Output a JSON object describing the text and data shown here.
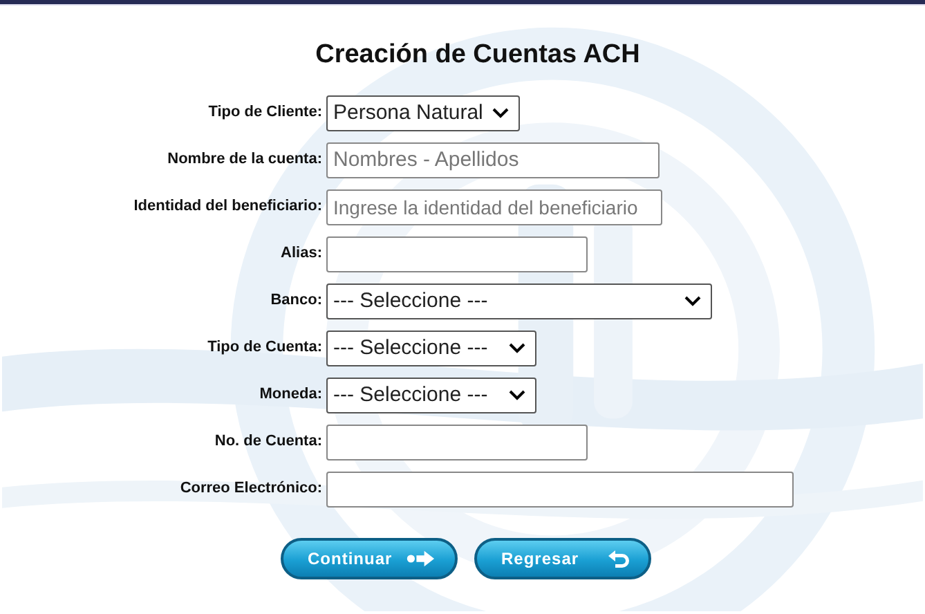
{
  "title": "Creación de Cuentas ACH",
  "fields": [
    {
      "kind": "select",
      "label": "Tipo de Cliente:",
      "value": "Persona Natural"
    },
    {
      "kind": "text",
      "label": "Nombre de la cuenta:",
      "placeholder": "Nombres - Apellidos"
    },
    {
      "kind": "text",
      "label": "Identidad del beneficiario:",
      "placeholder": "Ingrese la identidad del beneficiario"
    },
    {
      "kind": "text",
      "label": "Alias:"
    },
    {
      "kind": "select",
      "label": "Banco:",
      "value": "--- Seleccione ---"
    },
    {
      "kind": "select",
      "label": "Tipo de Cuenta:",
      "value": "--- Seleccione ---"
    },
    {
      "kind": "select",
      "label": "Moneda:",
      "value": "--- Seleccione ---"
    },
    {
      "kind": "text",
      "label": "No. de Cuenta:"
    },
    {
      "kind": "text",
      "label": "Correo Electrónico:"
    }
  ],
  "buttons": [
    {
      "label": "Continuar",
      "kind": "forward"
    },
    {
      "label": "Regresar",
      "kind": "back"
    }
  ]
}
